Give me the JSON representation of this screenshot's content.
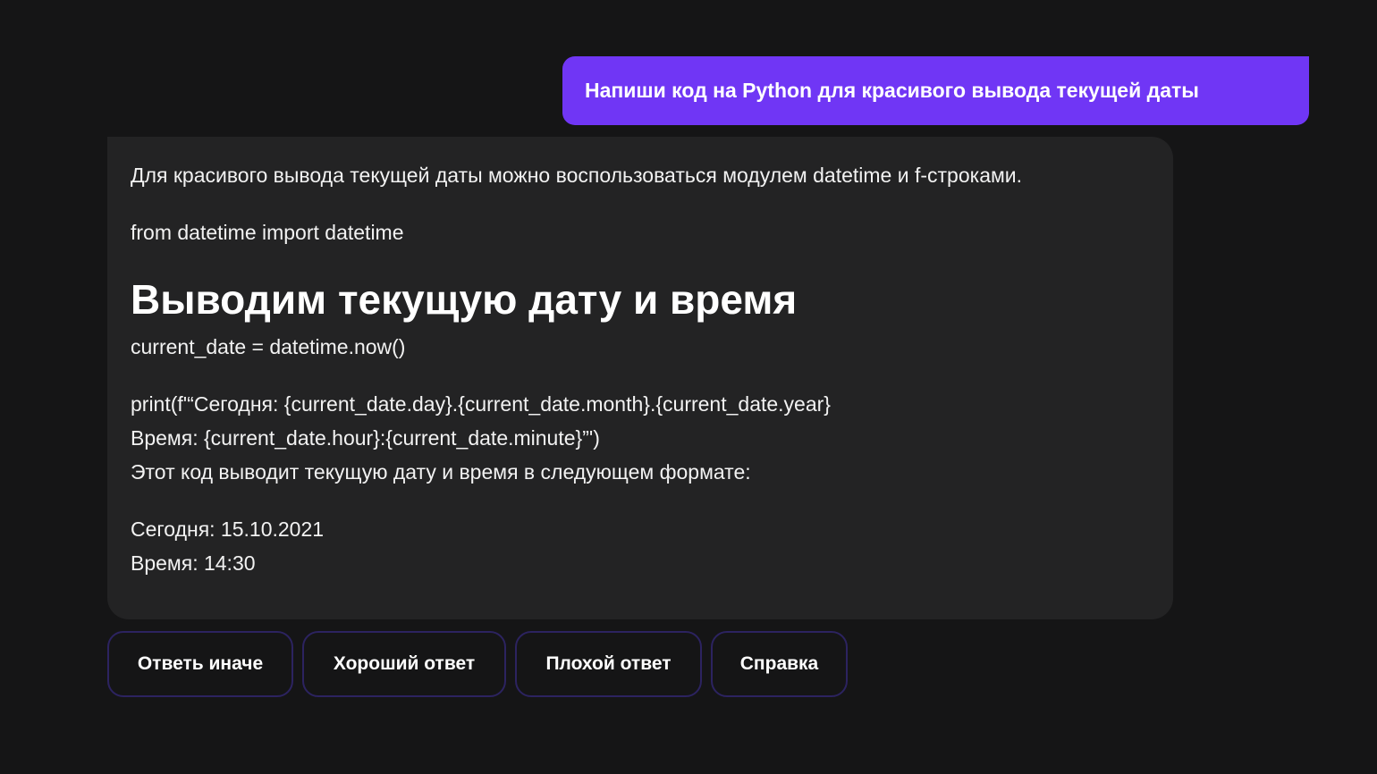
{
  "user_message": {
    "text": "Напиши код на Python для красивого вывода текущей даты"
  },
  "assistant_message": {
    "intro": "Для красивого вывода текущей даты можно воспользоваться модулем datetime и f-строками.",
    "import_line": "from datetime import datetime",
    "heading": "Выводим текущую дату и время",
    "now_line": "current_date = datetime.now()",
    "print_line_1": "print(f'“Сегодня: {current_date.day}.{current_date.month}.{current_date.year}",
    "print_line_2": "Время: {current_date.hour}:{current_date.minute}”')",
    "description": "Этот код выводит текущую дату и время в следующем формате:",
    "output_line_1": "Сегодня: 15.10.2021",
    "output_line_2": "Время: 14:30"
  },
  "actions": {
    "answer_differently": "Ответь иначе",
    "good_answer": "Хороший ответ",
    "bad_answer": "Плохой ответ",
    "help": "Справка"
  },
  "colors": {
    "background": "#151516",
    "user_bubble": "#7036f5",
    "assistant_bubble": "#232324",
    "button_border": "#2c2360",
    "text": "#ffffff"
  }
}
